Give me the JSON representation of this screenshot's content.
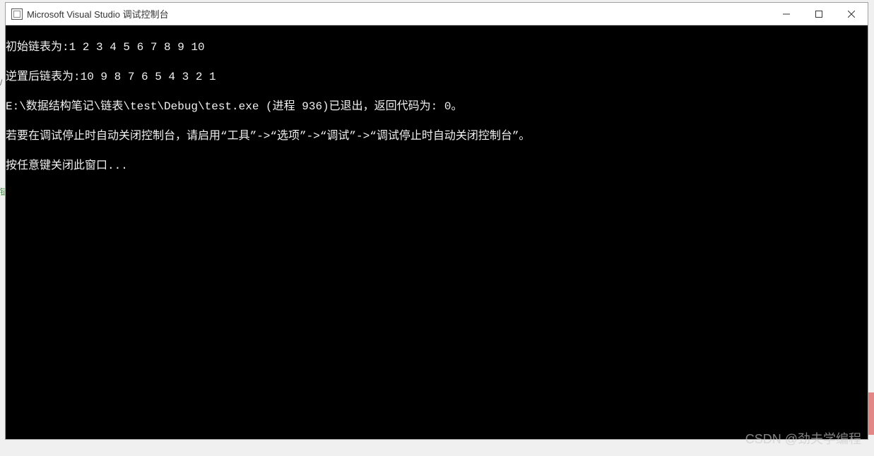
{
  "window": {
    "title": "Microsoft Visual Studio 调试控制台"
  },
  "console": {
    "line1": "初始链表为:1 2 3 4 5 6 7 8 9 10",
    "line2": "逆置后链表为:10 9 8 7 6 5 4 3 2 1",
    "line3": "E:\\数据结构笔记\\链表\\test\\Debug\\test.exe (进程 936)已退出，返回代码为: 0。",
    "line4": "若要在调试停止时自动关闭控制台，请启用“工具”->“选项”->“调试”->“调试停止时自动关闭控制台”。",
    "line5": "按任意键关闭此窗口..."
  },
  "watermark": {
    "text": "CSDN @劲夫学编程"
  },
  "fragments": {
    "left1": "/",
    "left2": "链"
  }
}
